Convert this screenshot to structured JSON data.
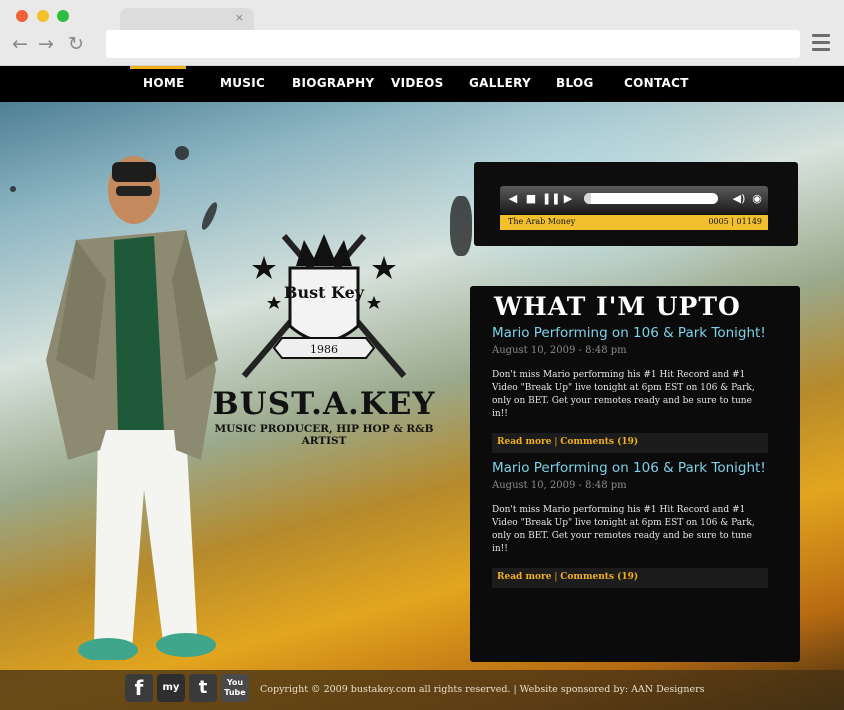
{
  "browser": {
    "tab_close": "×",
    "back_icon": "←",
    "forward_icon": "→",
    "reload_icon": "↻",
    "url": ""
  },
  "nav": {
    "items": [
      {
        "label": "HOME",
        "active": true
      },
      {
        "label": "MUSIC"
      },
      {
        "label": "BIOGRAPHY"
      },
      {
        "label": "VIDEOS"
      },
      {
        "label": "GALLERY"
      },
      {
        "label": "BLOG"
      },
      {
        "label": "CONTACT"
      }
    ]
  },
  "logo": {
    "badge_text": "Bust Key",
    "badge_year": "1986",
    "title": "BUST.A.KEY",
    "subtitle": "MUSIC PRODUCER, HIP HOP & R&B ARTIST"
  },
  "player": {
    "track_name": "The Arab Money",
    "time": "0005 | 01149",
    "progress": 0.05,
    "icons": [
      "rewind-icon",
      "stop-icon",
      "pause-icon",
      "forward-icon",
      "volume-icon",
      "play-circle-icon"
    ]
  },
  "posts": {
    "heading": "WHAT I'M UPTO",
    "items": [
      {
        "title": "Mario Performing on 106 & Park Tonight!",
        "date": "August 10, 2009 - 8:48 pm",
        "body": "Don't miss Mario performing his #1 Hit Record and #1 Video \"Break Up\" live tonight at 6pm EST on 106 & Park, only on BET. Get your remotes ready and be sure to tune in!!",
        "read_more": "Read more",
        "sep": "|",
        "comments": "Comments (19)"
      },
      {
        "title": "Mario Performing on 106 & Park Tonight!",
        "date": "August 10, 2009 - 8:48 pm",
        "body": "Don't miss Mario performing his #1 Hit Record and #1 Video \"Break Up\" live tonight at 6pm EST on 106 & Park, only on BET. Get your remotes ready and be sure to tune in!!",
        "read_more": "Read more",
        "sep": "|",
        "comments": "Comments (19)"
      }
    ]
  },
  "footer": {
    "social": [
      {
        "label": "f",
        "icon": "facebook-icon",
        "color": "#3b3b3b"
      },
      {
        "label": "my",
        "icon": "myspace-icon",
        "color": "#2e2e2e"
      },
      {
        "label": "t",
        "icon": "twitter-icon",
        "color": "#3a3a3a"
      },
      {
        "label": "You Tube",
        "icon": "youtube-icon",
        "color": "#4a4a4a"
      }
    ],
    "copyright": "Copyright © 2009 bustakey.com all rights reserved. | Website sponsored by: AAN Designers"
  },
  "colors": {
    "accent": "#f2b11b",
    "link": "#7fd2e8",
    "panel": "#0b0b0b"
  }
}
